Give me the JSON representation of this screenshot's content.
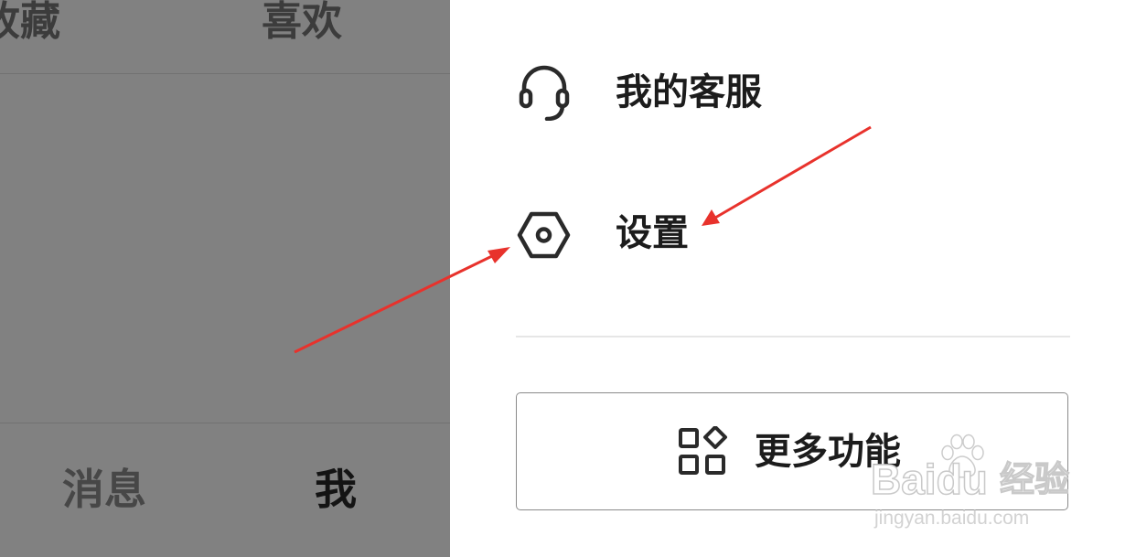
{
  "left_panel": {
    "top_tabs": [
      "收藏",
      "喜欢"
    ],
    "bottom_tabs": [
      "消息",
      "我"
    ]
  },
  "menu": {
    "items": [
      {
        "label": "我的客服",
        "icon": "headset-icon"
      },
      {
        "label": "设置",
        "icon": "hexagon-gear-icon"
      }
    ],
    "more_button": {
      "label": "更多功能",
      "icon": "apps-grid-icon"
    }
  },
  "watermark": {
    "logo": "Baidu",
    "cn": "经验",
    "url": "jingyan.baidu.com"
  },
  "colors": {
    "overlay": "#818181",
    "arrow": "#e8322c",
    "text": "#1c1c1c"
  }
}
